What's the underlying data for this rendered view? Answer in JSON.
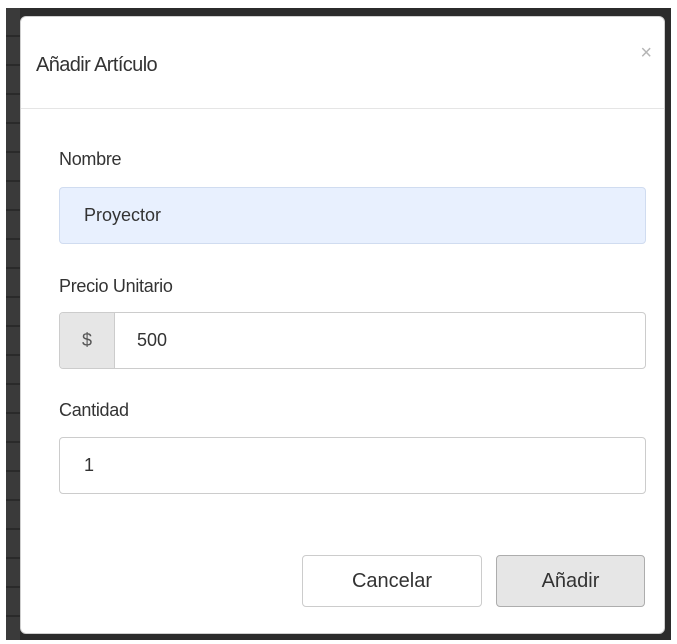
{
  "dialog": {
    "title": "Añadir Artículo",
    "close_symbol": "×"
  },
  "form": {
    "name_label": "Nombre",
    "name_value": "Proyector",
    "price_label": "Precio Unitario",
    "price_addon": "$",
    "price_value": "500",
    "quantity_label": "Cantidad",
    "quantity_value": "1"
  },
  "footer": {
    "cancel_label": "Cancelar",
    "add_label": "Añadir"
  },
  "colors": {
    "autofill_background": "#e8f0fe",
    "primary_action_background": "#e6e6e6"
  },
  "icons": {
    "close": "close-icon"
  }
}
